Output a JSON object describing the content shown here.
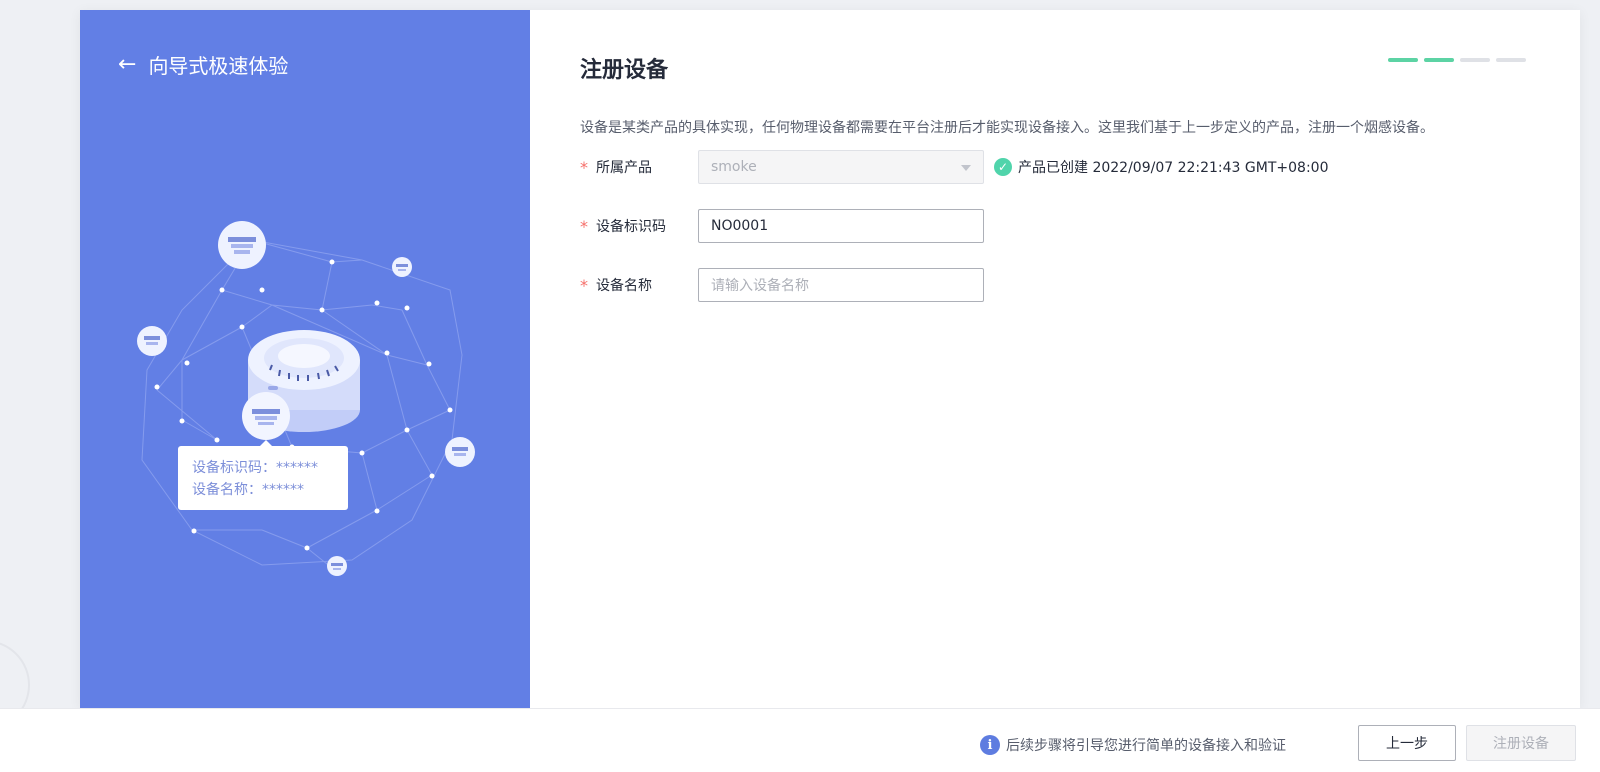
{
  "left_panel": {
    "back_label": "向导式极速体验",
    "illustration": {
      "card_line1": "设备标识码：******",
      "card_line2": "设备名称：******"
    }
  },
  "main": {
    "title": "注册设备",
    "steps_total": 4,
    "steps_done": 2,
    "description": "设备是某类产品的具体实现，任何物理设备都需要在平台注册后才能实现设备接入。这里我们基于上一步定义的产品，注册一个烟感设备。",
    "form": {
      "product": {
        "required_mark": "*",
        "label": "所属产品",
        "value": "smoke",
        "created_text": "产品已创建 2022/09/07 22:21:43 GMT+08:00"
      },
      "device_id": {
        "required_mark": "*",
        "label": "设备标识码",
        "value": "NO0001"
      },
      "device_name": {
        "required_mark": "*",
        "label": "设备名称",
        "value": "",
        "placeholder": "请输入设备名称"
      }
    }
  },
  "footer": {
    "tip": "后续步骤将引导您进行简单的设备接入和验证",
    "prev_label": "上一步",
    "submit_label": "注册设备"
  },
  "colors": {
    "left_panel_bg": "#627fe5",
    "progress_done": "#5cd3a4",
    "required": "#f66f6a",
    "success": "#50d4ab",
    "info": "#5e7ce0"
  }
}
